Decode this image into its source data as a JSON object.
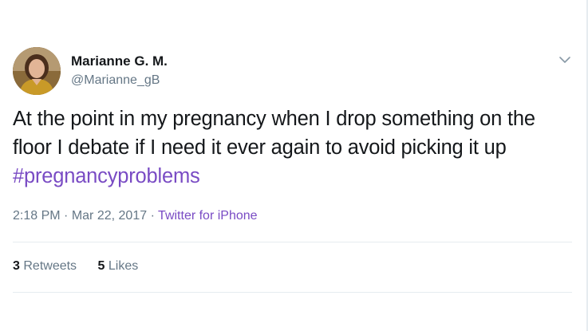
{
  "author": {
    "display_name": "Marianne G. M.",
    "handle": "@Marianne_gB"
  },
  "tweet": {
    "text": "At the point in my pregnancy when I drop something on the floor I debate if I need it ever again to avoid picking it up ",
    "hashtag": "#pregnancyproblems"
  },
  "meta": {
    "time": "2:18 PM",
    "separator": "·",
    "date": "Mar 22, 2017",
    "source": "Twitter for iPhone"
  },
  "stats": {
    "retweets_count": "3",
    "retweets_label": "Retweets",
    "likes_count": "5",
    "likes_label": "Likes"
  },
  "icons": {
    "menu": "chevron-down-icon"
  },
  "colors": {
    "link": "#794bc4",
    "secondary_text": "#657786",
    "primary_text": "#14171a",
    "divider": "#e6ecf0"
  }
}
